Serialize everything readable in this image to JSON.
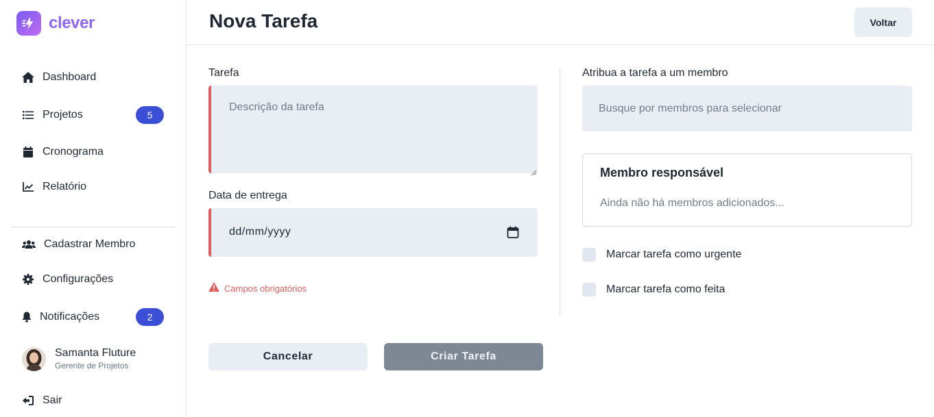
{
  "brand": {
    "name": "clever",
    "colors": {
      "primary": "#8e67f0",
      "badge": "#3a4fd6",
      "error": "#e05d5d"
    }
  },
  "sidebar": {
    "items": [
      {
        "label": "Dashboard",
        "icon": "home-icon"
      },
      {
        "label": "Projetos",
        "icon": "list-icon",
        "badge": "5"
      },
      {
        "label": "Cronograma",
        "icon": "calendar-icon"
      },
      {
        "label": "Relatório",
        "icon": "chart-icon"
      },
      {
        "label": "Cadastrar Membro",
        "icon": "users-icon"
      },
      {
        "label": "Configurações",
        "icon": "gear-icon"
      },
      {
        "label": "Notificações",
        "icon": "bell-icon",
        "badge": "2"
      }
    ],
    "profile": {
      "name": "Samanta Fluture",
      "role": "Gerente de Projetos"
    },
    "logout": {
      "label": "Sair",
      "icon": "logout-icon"
    }
  },
  "header": {
    "title": "Nova Tarefa",
    "back_label": "Voltar"
  },
  "form": {
    "task": {
      "label": "Tarefa",
      "placeholder": "Descrição da tarefa"
    },
    "due_date": {
      "label": "Data de entrega",
      "value": "dd/mm/yyyy"
    },
    "error": "Campos obrigatórios",
    "assign": {
      "label": "Atribua a tarefa a um membro",
      "placeholder": "Busque por membros para selecionar"
    },
    "responsible": {
      "title": "Membro responsável",
      "empty": "Ainda não há membros adicionados..."
    },
    "urgent_label": "Marcar tarefa como urgente",
    "done_label": "Marcar tarefa como feita",
    "cancel_label": "Cancelar",
    "create_label": "Criar Tarefa"
  }
}
